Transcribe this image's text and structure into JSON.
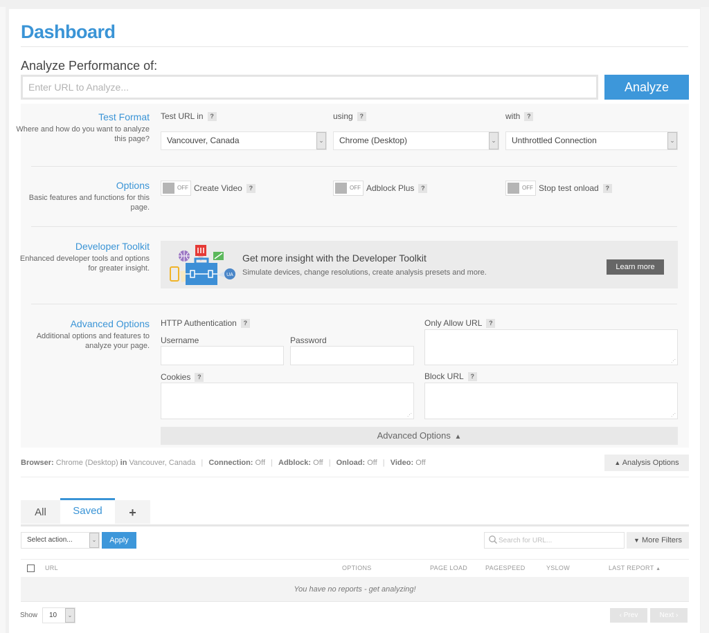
{
  "header": {
    "title": "Dashboard",
    "analyze_label": "Analyze Performance of:",
    "url_placeholder": "Enter URL to Analyze...",
    "url_value": "",
    "analyze_button": "Analyze"
  },
  "test_format": {
    "title": "Test Format",
    "description": "Where and how do you want to analyze this page?",
    "location_label": "Test URL in",
    "location_value": "Vancouver, Canada",
    "browser_label": "using",
    "browser_value": "Chrome (Desktop)",
    "connection_label": "with",
    "connection_value": "Unthrottled Connection",
    "help": "?"
  },
  "options": {
    "title": "Options",
    "description": "Basic features and functions for this page.",
    "toggles": [
      {
        "label": "Create Video",
        "state": "OFF"
      },
      {
        "label": "Adblock Plus",
        "state": "OFF"
      },
      {
        "label": "Stop test onload",
        "state": "OFF"
      }
    ]
  },
  "developer_toolkit": {
    "title": "Developer Toolkit",
    "description": "Enhanced developer tools and options for greater insight.",
    "promo_title": "Get more insight with the Developer Toolkit",
    "promo_desc": "Simulate devices, change resolutions, create analysis presets and more.",
    "learn_more": "Learn more",
    "ua_badge": "UA"
  },
  "advanced": {
    "title": "Advanced Options",
    "description": "Additional options and features to analyze your page.",
    "http_auth_label": "HTTP Authentication",
    "username_label": "Username",
    "password_label": "Password",
    "cookies_label": "Cookies",
    "only_allow_label": "Only Allow URL",
    "block_label": "Block URL",
    "collapse_bar": "Advanced Options",
    "collapse_icon": "▲"
  },
  "summary": {
    "browser_key": "Browser:",
    "browser_val": "Chrome (Desktop)",
    "in_key": "in",
    "location_val": "Vancouver, Canada",
    "connection_key": "Connection:",
    "connection_val": "Off",
    "adblock_key": "Adblock:",
    "adblock_val": "Off",
    "onload_key": "Onload:",
    "onload_val": "Off",
    "video_key": "Video:",
    "video_val": "Off",
    "separator": "|",
    "analysis_options_button": "Analysis Options"
  },
  "reports": {
    "tabs": [
      {
        "label": "All",
        "active": false
      },
      {
        "label": "Saved",
        "active": true
      },
      {
        "label": "+",
        "active": false
      }
    ],
    "action_select": "Select action...",
    "apply_button": "Apply",
    "search_placeholder": "Search for URL...",
    "more_filters": "More Filters",
    "columns": [
      "URL",
      "OPTIONS",
      "PAGE LOAD",
      "PAGESPEED",
      "YSLOW",
      "LAST REPORT"
    ],
    "sort_indicator": "▲",
    "empty_message": "You have no reports - get analyzing!",
    "show_label": "Show",
    "page_size": "10",
    "prev_button": "‹ Prev",
    "next_button": "Next ›"
  },
  "colors": {
    "accent": "#3d97da",
    "title_blue": "#3a94d6",
    "panel_bg": "#f8f8f8",
    "dark_button": "#666666"
  }
}
